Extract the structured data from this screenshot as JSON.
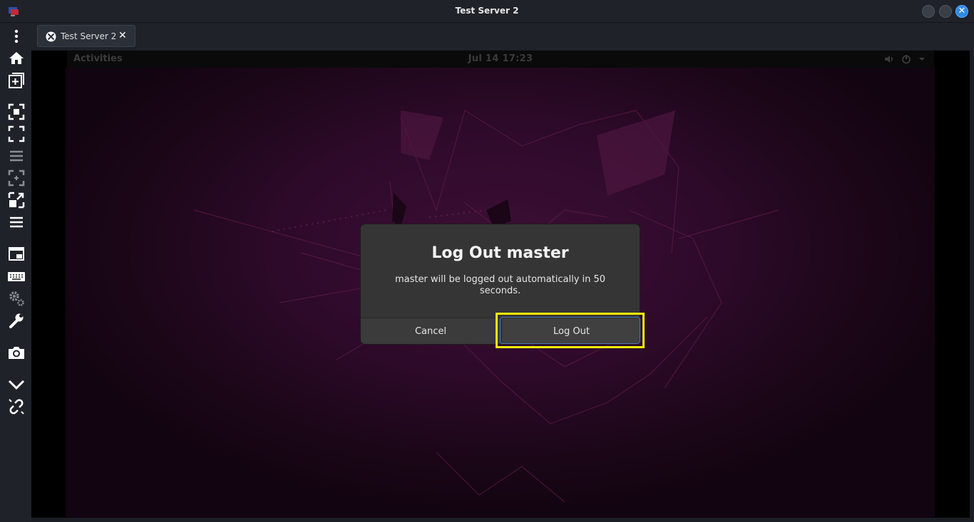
{
  "window": {
    "title": "Test Server 2"
  },
  "tab": {
    "label": "Test Server 2",
    "close_glyph": "✕"
  },
  "toolbar": {
    "icons": [
      "menu-icon",
      "home-icon",
      "new-tab-icon",
      "fit-window-icon",
      "fullscreen-icon",
      "scale-mode-icon",
      "resize-icon",
      "toggle-toolbar-icon",
      "multi-monitor-icon",
      "keyboard-icon",
      "preferences-icon",
      "tools-icon",
      "screenshot-icon",
      "minimize-toolbar-icon",
      "disconnect-icon"
    ]
  },
  "remote": {
    "activities": "Activities",
    "clock": "Jul 14  17:23"
  },
  "dialog": {
    "title": "Log Out master",
    "message": "master will be logged out automatically in 50 seconds.",
    "cancel_label": "Cancel",
    "logout_label": "Log Out"
  },
  "colors": {
    "highlight": "#f2ee0a",
    "close_button": "#2f8ae5"
  }
}
